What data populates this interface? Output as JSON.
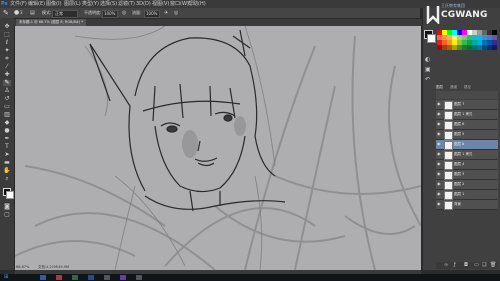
{
  "menubar": {
    "items": [
      "文件(F)",
      "编辑(E)",
      "图像(I)",
      "图层(L)",
      "类型(Y)",
      "选择(S)",
      "滤镜(T)",
      "3D(D)",
      "视图(V)",
      "窗口(W)",
      "帮助(H)"
    ]
  },
  "options": {
    "brush_size": "3",
    "mode_label": "模式:",
    "mode_value": "正常",
    "opacity_label": "不透明度:",
    "opacity_value": "100%",
    "flow_label": "流量:",
    "flow_value": "100%"
  },
  "document": {
    "tab_label": "未标题-1 @ 66.7% (图层 8, RGB/8#) *"
  },
  "status": {
    "zoom": "66.67%",
    "doc_info": "文档:4.21M/49.9M"
  },
  "brand": {
    "name": "CGWANG",
    "tagline": "王氏教育集团"
  },
  "panel": {
    "tab_layers": "图层",
    "tab_channels": "通道",
    "tab_paths": "路径"
  },
  "layers": [
    {
      "name": "图层 7",
      "selected": false
    },
    {
      "name": "图层 1 拷贝",
      "selected": false
    },
    {
      "name": "图层 6",
      "selected": false
    },
    {
      "name": "图层 5",
      "selected": false
    },
    {
      "name": "图层 8",
      "selected": true
    },
    {
      "name": "图层 1 拷贝",
      "selected": false
    },
    {
      "name": "图层 4",
      "selected": false
    },
    {
      "name": "图层 3",
      "selected": false
    },
    {
      "name": "图层 2",
      "selected": false
    },
    {
      "name": "图层 1",
      "selected": false
    },
    {
      "name": "背景",
      "selected": false
    }
  ],
  "colors": {
    "foreground": "#111111",
    "background": "#ffffff",
    "canvas": "#aeaeb0",
    "selected_layer": "#6b86a8"
  },
  "icons": {
    "tools": [
      "move-tool-icon",
      "marquee-tool-icon",
      "lasso-tool-icon",
      "quick-select-tool-icon",
      "crop-tool-icon",
      "eyedropper-tool-icon",
      "healing-tool-icon",
      "brush-tool-icon",
      "clone-stamp-tool-icon",
      "history-brush-tool-icon",
      "eraser-tool-icon",
      "gradient-tool-icon",
      "blur-tool-icon",
      "dodge-tool-icon",
      "pen-tool-icon",
      "type-tool-icon",
      "path-select-tool-icon",
      "shape-tool-icon",
      "hand-tool-icon",
      "zoom-tool-icon"
    ]
  }
}
